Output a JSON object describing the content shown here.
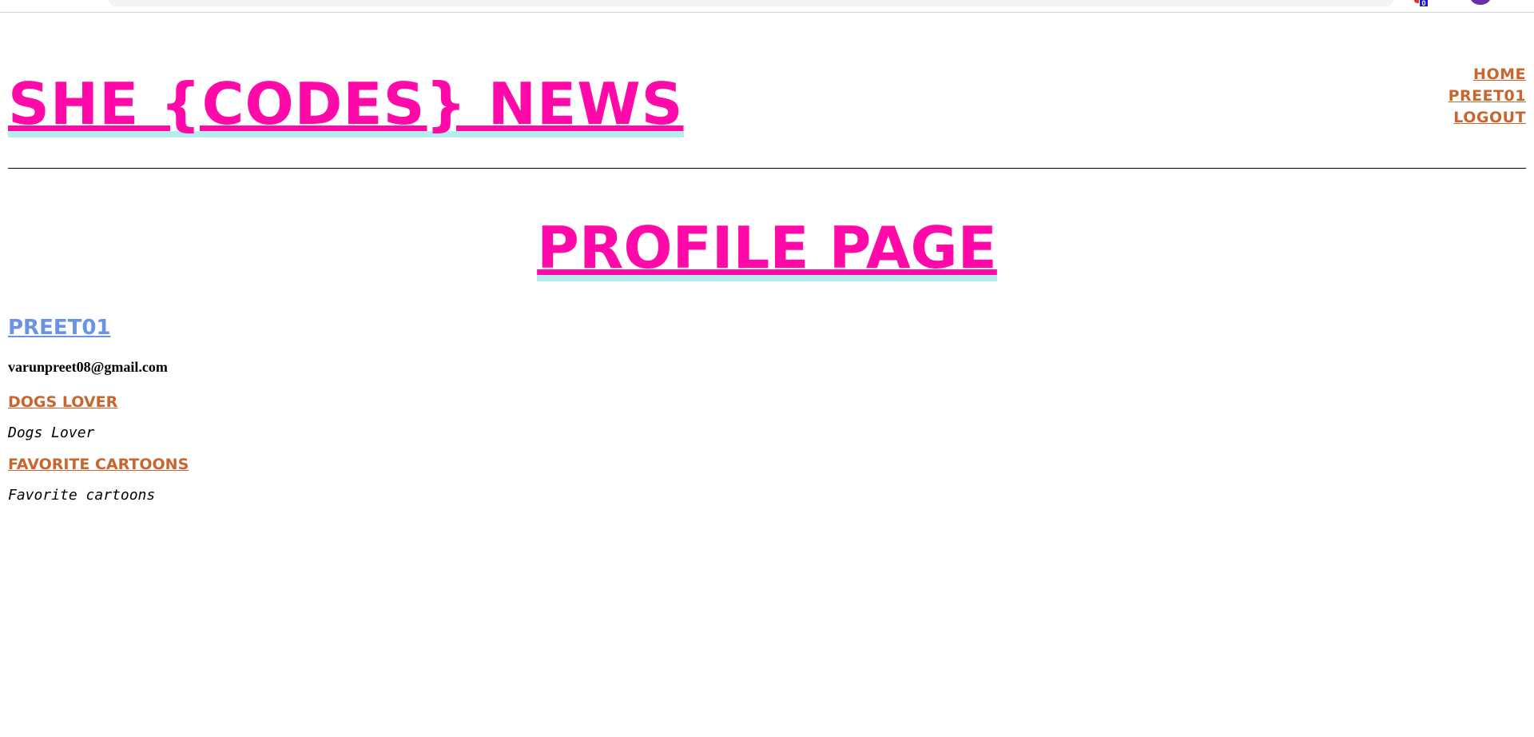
{
  "browser": {
    "extension_badge": "0"
  },
  "header": {
    "site_title": "SHE {CODES} NEWS",
    "nav": {
      "home": "HOME",
      "profile": "PREET01",
      "logout": "LOGOUT"
    }
  },
  "page": {
    "heading": "PROFILE PAGE"
  },
  "profile": {
    "username": "PREET01",
    "email": "varunpreet08@gmail.com"
  },
  "stories": [
    {
      "title": "DOGS LOVER",
      "description": "Dogs Lover"
    },
    {
      "title": "FAVORITE CARTOONS",
      "description": "Favorite cartoons"
    }
  ],
  "colors": {
    "title_pink": "#ff0aa9",
    "title_highlight": "#b5ecee",
    "link_orange": "#c8662e",
    "username_blue": "#6b93e0"
  }
}
